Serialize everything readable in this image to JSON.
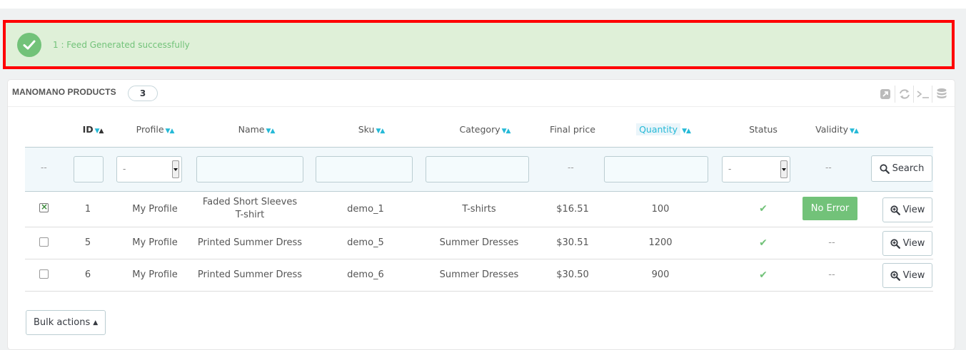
{
  "alert": {
    "message": "1 : Feed Generated successfully"
  },
  "panel": {
    "title": "MANOMANO PRODUCTS",
    "count": "3",
    "toolbar": [
      "export-icon",
      "refresh-icon",
      "sql-query-icon",
      "database-icon"
    ]
  },
  "table": {
    "headers": {
      "id": "ID",
      "profile": "Profile",
      "name": "Name",
      "sku": "Sku",
      "category": "Category",
      "final_price": "Final price",
      "quantity": "Quantity",
      "status": "Status",
      "validity": "Validity"
    },
    "filters": {
      "dash": "--",
      "profile_select": "-",
      "status_select": "-",
      "search_label": "Search"
    },
    "rows": [
      {
        "checked": true,
        "id": "1",
        "profile": "My Profile",
        "name_line1": "Faded Short Sleeves",
        "name_line2": "T-shirt",
        "sku": "demo_1",
        "category": "T-shirts",
        "price": "$16.51",
        "quantity": "100",
        "validity": "No Error",
        "view": "View"
      },
      {
        "checked": false,
        "id": "5",
        "profile": "My Profile",
        "name": "Printed Summer Dress",
        "sku": "demo_5",
        "category": "Summer Dresses",
        "price": "$30.51",
        "quantity": "1200",
        "validity": "--",
        "view": "View"
      },
      {
        "checked": false,
        "id": "6",
        "profile": "My Profile",
        "name": "Printed Summer Dress",
        "sku": "demo_6",
        "category": "Summer Dresses",
        "price": "$30.50",
        "quantity": "900",
        "validity": "--",
        "view": "View"
      }
    ]
  },
  "bulk_actions": {
    "label": "Bulk actions"
  },
  "colors": {
    "success": "#72c279",
    "alert_bg": "#dff0d8",
    "highlight": "#ff0000",
    "accent": "#25b9d7"
  }
}
